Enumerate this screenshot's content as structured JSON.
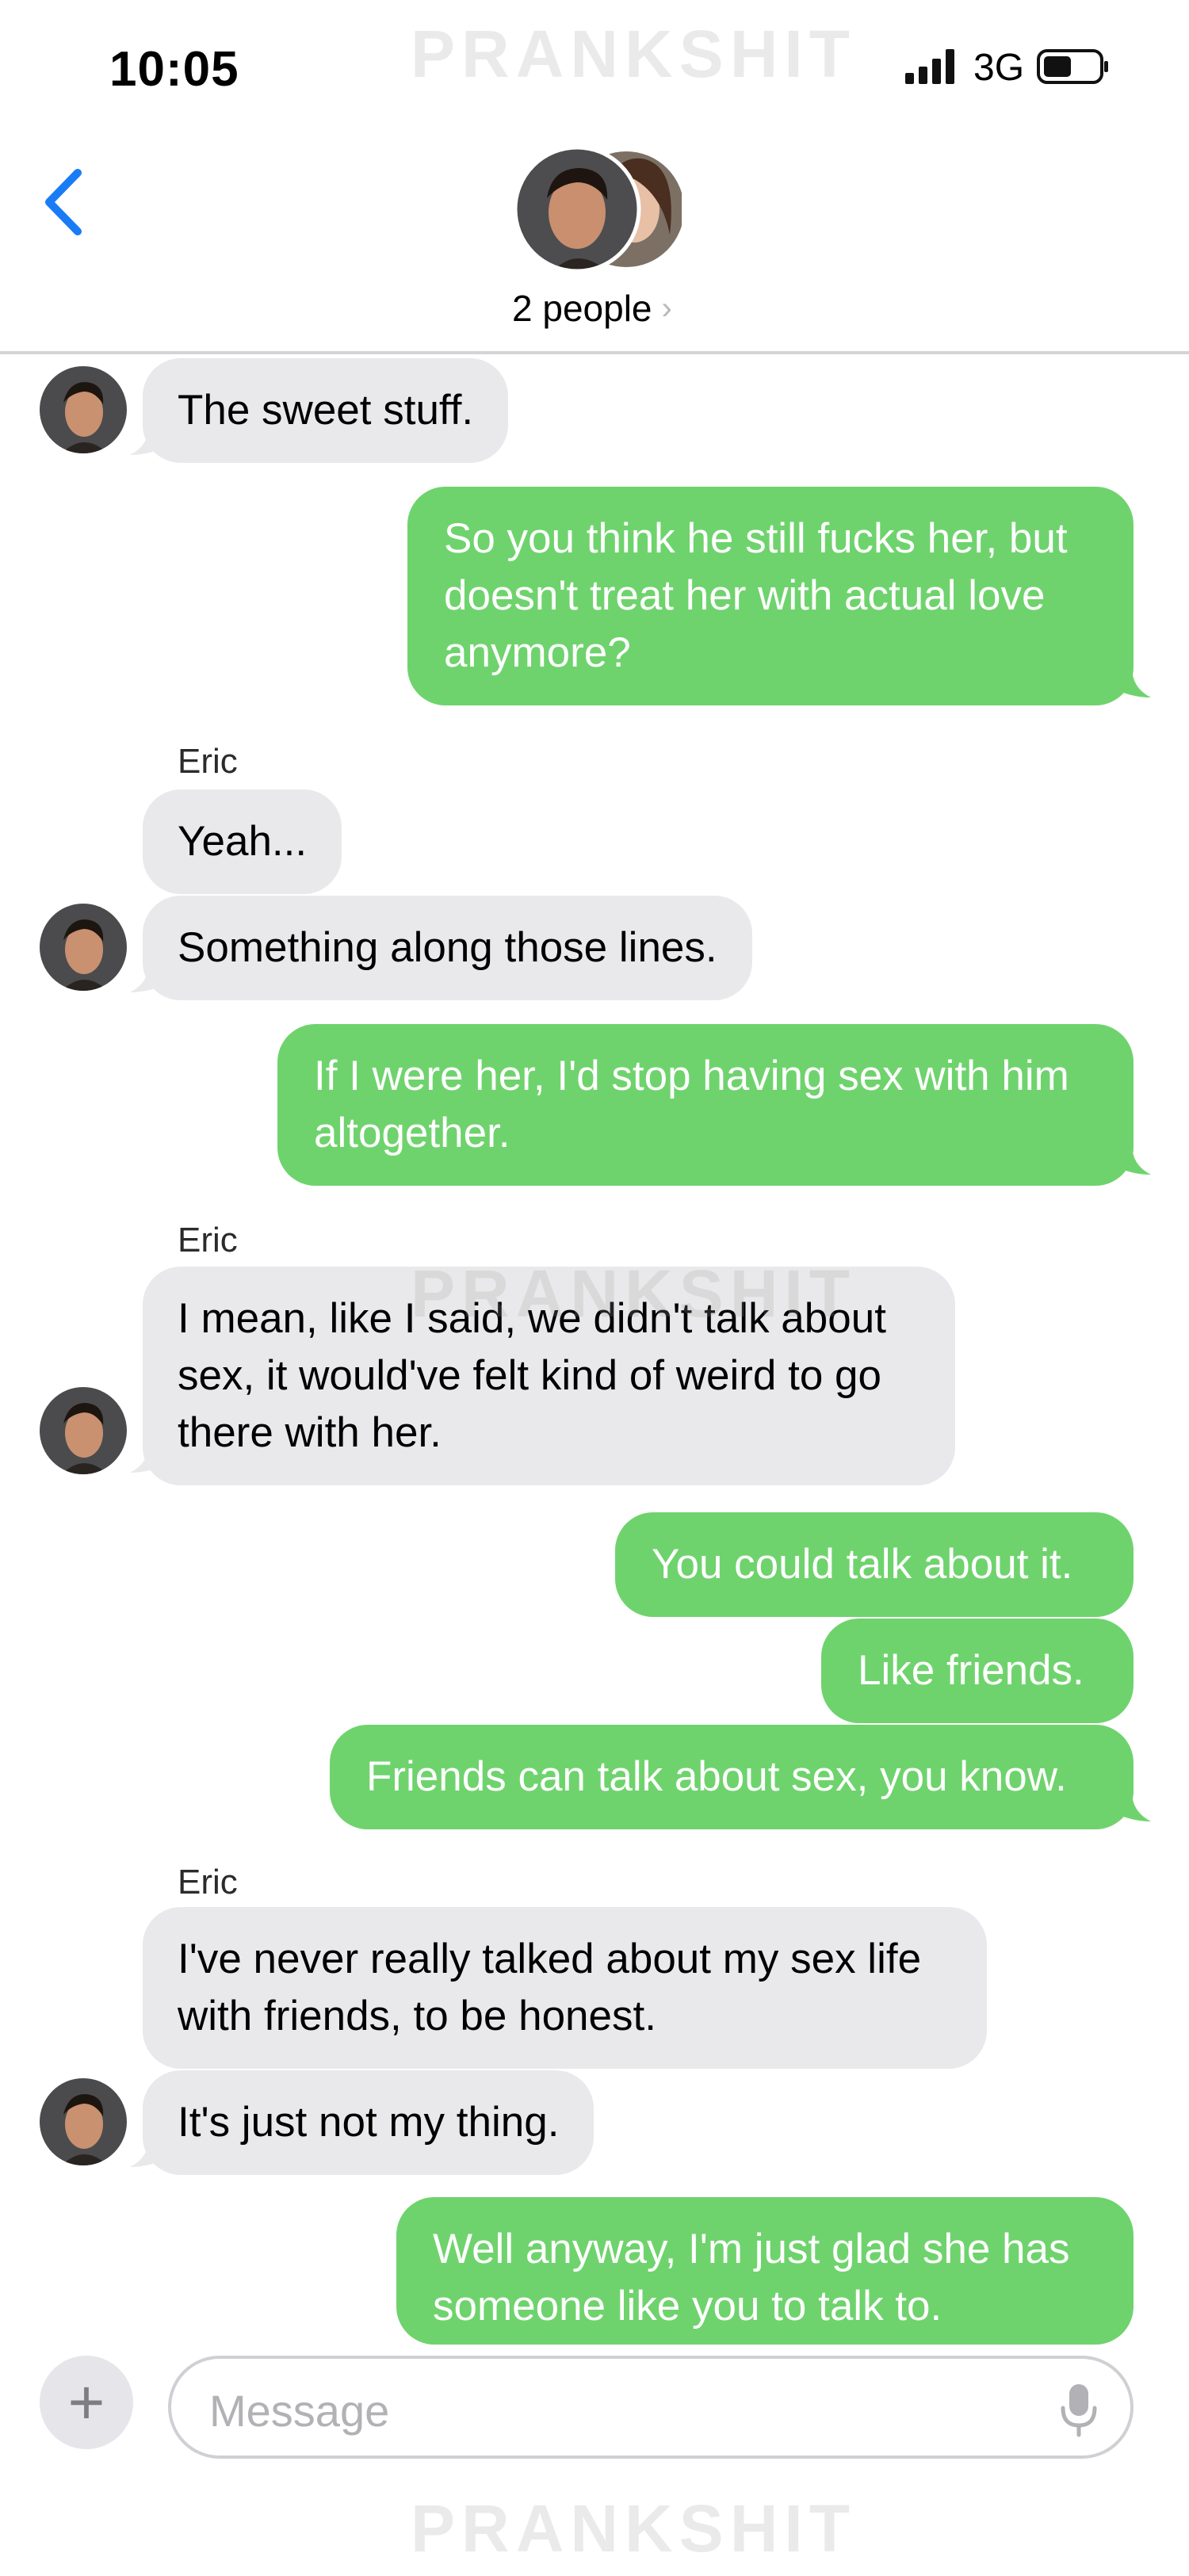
{
  "status_bar": {
    "time": "10:05",
    "network": "3G"
  },
  "watermark": "PRANKSHIT",
  "header": {
    "title": "2 people"
  },
  "messages": [
    {
      "side": "in",
      "text": "The sweet stuff."
    },
    {
      "side": "out",
      "text": "So you think he still fucks her, but doesn't treat her with actual love anymore?"
    },
    {
      "side": "in",
      "sender": "Eric",
      "text": "Yeah..."
    },
    {
      "side": "in",
      "text": "Something along those lines."
    },
    {
      "side": "out",
      "text": "If I were her, I'd stop having sex with him altogether."
    },
    {
      "side": "in",
      "sender": "Eric",
      "text": "I mean, like I said, we didn't talk about sex, it would've felt kind of weird to go there with her."
    },
    {
      "side": "out",
      "text": "You could talk about it."
    },
    {
      "side": "out",
      "text": "Like friends."
    },
    {
      "side": "out",
      "text": "Friends can talk about sex, you know."
    },
    {
      "side": "in",
      "sender": "Eric",
      "text": "I've never really talked about my sex life with friends, to be honest."
    },
    {
      "side": "in",
      "text": "It's just not my thing."
    },
    {
      "side": "out",
      "text": "Well anyway, I'm just glad she has someone like you to talk to."
    }
  ],
  "composer": {
    "placeholder": "Message"
  },
  "colors": {
    "outgoing": "#6fd36d",
    "incoming": "#e9e9eb",
    "accent": "#1a7cf5"
  }
}
